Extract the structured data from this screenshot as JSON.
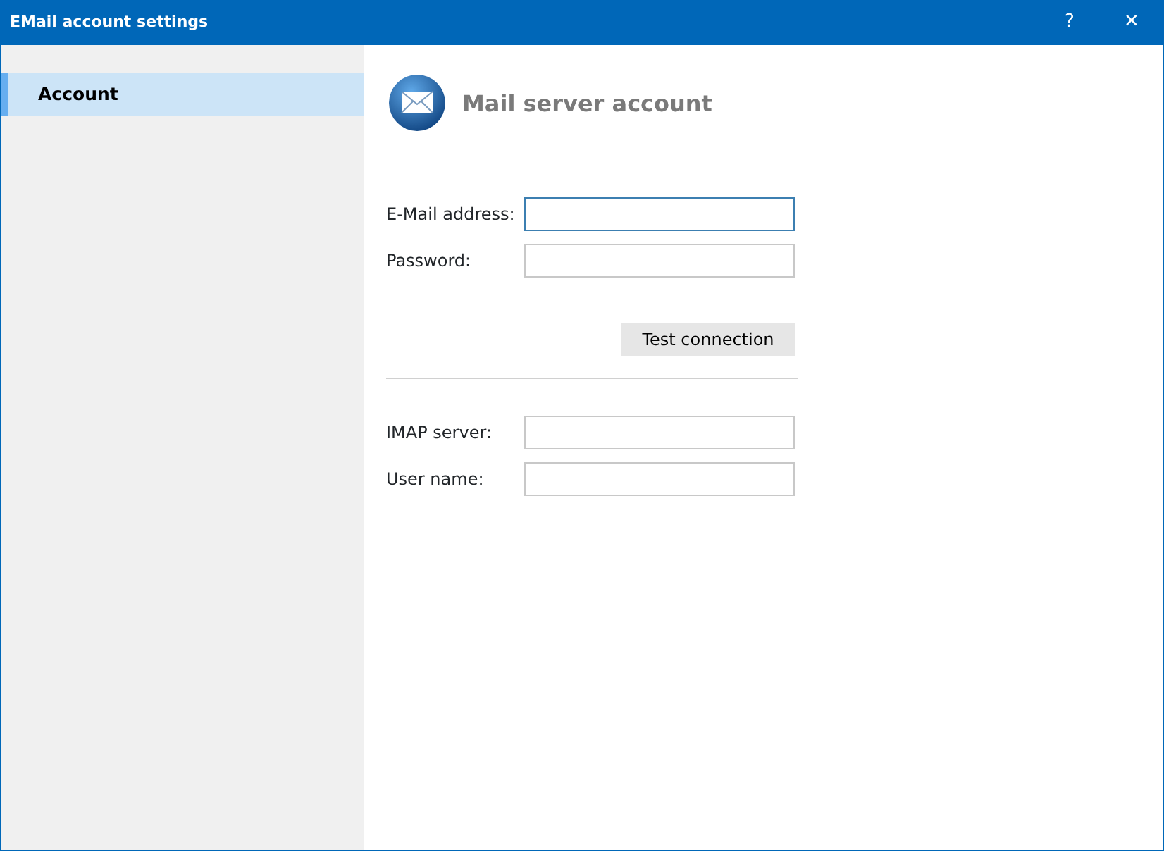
{
  "window": {
    "title": "EMail account settings",
    "buttons": [
      "?",
      "✕"
    ]
  },
  "sidebar": {
    "items": [
      {
        "label": "Account",
        "selected": true
      }
    ]
  },
  "header": {
    "title": "Mail server account"
  },
  "login_fields": [
    {
      "label": "E-Mail address:",
      "focused": true
    },
    {
      "label": "Password:",
      "focused": false
    }
  ],
  "test_button": "Test connection",
  "server_fields": [
    {
      "label": "IMAP server:",
      "focused": false
    },
    {
      "label": "User name:",
      "focused": false
    }
  ]
}
